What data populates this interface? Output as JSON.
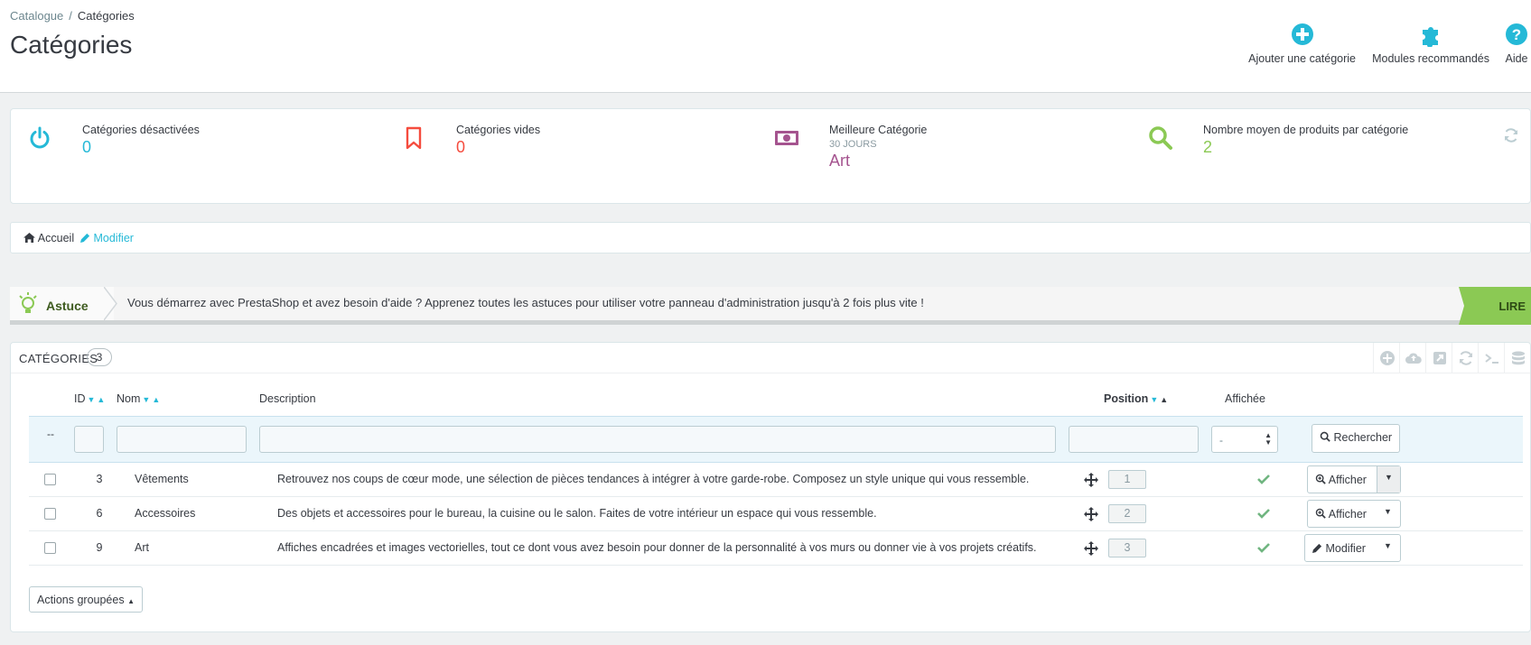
{
  "breadcrumb": {
    "parent": "Catalogue",
    "separator": "/",
    "current": "Catégories"
  },
  "page_title": "Catégories",
  "toolbar": {
    "add_category": "Ajouter une catégorie",
    "recommended_modules": "Modules recommandés",
    "help": "Aide"
  },
  "kpis": [
    {
      "label": "Catégories désactivées",
      "sub": "",
      "value": "0",
      "icon": "power-icon",
      "color": "#25b9d7"
    },
    {
      "label": "Catégories vides",
      "sub": "",
      "value": "0",
      "icon": "bookmark-icon",
      "color": "#f54c3e"
    },
    {
      "label": "Meilleure Catégorie",
      "sub": "30 JOURS",
      "value": "Art",
      "icon": "money-icon",
      "color": "#a5548f"
    },
    {
      "label": "Nombre moyen de produits par catégorie",
      "sub": "",
      "value": "2",
      "icon": "search-icon",
      "color": "#8bc954"
    }
  ],
  "tree": {
    "home": "Accueil",
    "edit": "Modifier"
  },
  "tip": {
    "label": "Astuce",
    "text": "Vous démarrez avec PrestaShop et avez besoin d'aide ? Apprenez toutes les astuces pour utiliser votre panneau d'administration jusqu'à 2 fois plus vite !",
    "read": "LIRE"
  },
  "list": {
    "title": "Catégories",
    "count": "3",
    "columns": {
      "id": "ID",
      "name": "Nom",
      "description": "Description",
      "position": "Position",
      "displayed": "Affichée"
    },
    "filter": {
      "dash": "--",
      "select_value": "-",
      "search": "Rechercher"
    },
    "rows": [
      {
        "id": "3",
        "name": "Vêtements",
        "description": "Retrouvez nos coups de cœur mode, une sélection de pièces tendances à intégrer à votre garde-robe. Composez un style unique qui vous ressemble.",
        "position": "1",
        "action": "Afficher"
      },
      {
        "id": "6",
        "name": "Accessoires",
        "description": "Des objets et accessoires pour le bureau, la cuisine ou le salon. Faites de votre intérieur un espace qui vous ressemble.",
        "position": "2",
        "action": "Afficher"
      },
      {
        "id": "9",
        "name": "Art",
        "description": "Affiches encadrées et images vectorielles, tout ce dont vous avez besoin pour donner de la personnalité à vos murs ou donner vie à vos projets créatifs.",
        "position": "3",
        "action": "Modifier"
      }
    ],
    "bulk_actions": "Actions groupées"
  },
  "colors": {
    "accent": "#25b9d7",
    "success": "#70b580",
    "tip_green": "#8bc954"
  }
}
